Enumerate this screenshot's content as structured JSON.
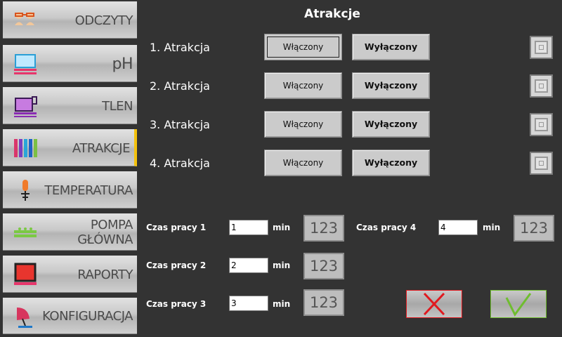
{
  "sidebar": {
    "items": [
      {
        "label": "ODCZYTY"
      },
      {
        "label": "pH"
      },
      {
        "label": "TLEN"
      },
      {
        "label": "ATRAKCJE",
        "active": true
      },
      {
        "label": "TEMPERATURA"
      },
      {
        "label_line1": "POMPA",
        "label_line2": "GŁÓWNA"
      },
      {
        "label": "RAPORTY"
      },
      {
        "label": "KONFIGURACJA"
      }
    ]
  },
  "header": {
    "title": "Atrakcje"
  },
  "attractions": [
    {
      "label": "1. Atrakcja",
      "on_label": "Włączony",
      "off_label": "Wyłączony"
    },
    {
      "label": "2. Atrakcja",
      "on_label": "Włączony",
      "off_label": "Wyłączony"
    },
    {
      "label": "3. Atrakcja",
      "on_label": "Włączony",
      "off_label": "Wyłączony"
    },
    {
      "label": "4. Atrakcja",
      "on_label": "Włączony",
      "off_label": "Wyłączony"
    }
  ],
  "timers": [
    {
      "label": "Czas pracy 1",
      "value": "1",
      "unit": "min",
      "keypad": "123"
    },
    {
      "label": "Czas pracy 2",
      "value": "2",
      "unit": "min",
      "keypad": "123"
    },
    {
      "label": "Czas pracy 3",
      "value": "3",
      "unit": "min",
      "keypad": "123"
    },
    {
      "label": "Czas pracy 4",
      "value": "4",
      "unit": "min",
      "keypad": "123"
    }
  ],
  "colors": {
    "accent": "#f4c20d",
    "cancel": "#e0191f",
    "confirm": "#6fbd2f"
  }
}
